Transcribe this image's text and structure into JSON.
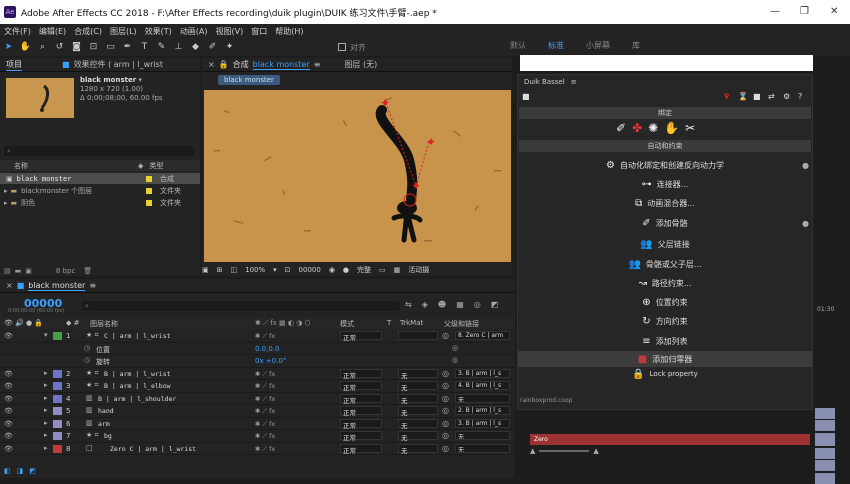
{
  "window": {
    "title": "Adobe After Effects CC 2018 - F:\\After Effects recording\\duik plugin\\DUIK 练习文件\\手臂-.aep *",
    "logo": "Ae"
  },
  "menu": [
    "文件(F)",
    "编辑(E)",
    "合成(C)",
    "图层(L)",
    "效果(T)",
    "动画(A)",
    "视图(V)",
    "窗口",
    "帮助(H)"
  ],
  "toolbar": {
    "snap_label": "对齐"
  },
  "workspaces": [
    "默认",
    "标准",
    "小屏幕",
    "库"
  ],
  "project": {
    "tab": "项目",
    "effects_tab": "效果控件 ( arm | l_wrist",
    "comp_name": "black monster",
    "comp_info1": "1280 x 720 (1.00)",
    "comp_info2": "Δ 0;00;08;00, 60.00 fps",
    "cols": [
      "名称",
      "类型"
    ],
    "items": [
      {
        "name": "black monster",
        "type": "合成"
      },
      {
        "name": "blackmonster 个图层",
        "type": "文件夹"
      },
      {
        "name": "阴色",
        "type": "文件夹"
      }
    ],
    "bpc": "8 bpc"
  },
  "comp": {
    "tab": "合成",
    "tab_name": "black monster",
    "layer_tab": "图层 (无)",
    "pill": "black monster",
    "zoom": "100%",
    "timecode": "00000",
    "quality": "完整",
    "camera": "活动摄"
  },
  "timeline": {
    "tab": "black monster",
    "timecode": "00000",
    "tc_sub": "0:00:00:00 (60.00 fps)",
    "cols": {
      "name": "图层名称",
      "mode": "模式",
      "t": "T",
      "trkmat": "TrkMat",
      "parent": "父级和链接"
    },
    "layers": [
      {
        "num": "1",
        "name": "C | arm | l_wrist",
        "mode": "正常",
        "trk": "",
        "parent": "8. Zero C | arm",
        "color": "#4a9e44",
        "expanded": true
      },
      {
        "num": "",
        "name": "位置",
        "value": "0.0,0.0",
        "sub": true
      },
      {
        "num": "",
        "name": "旋转",
        "value": "0x +0.0°",
        "sub": true
      },
      {
        "num": "2",
        "name": "B | arm | l_wrist",
        "mode": "正常",
        "trk": "无",
        "parent": "3. B | arm | l_s",
        "color": "#6e74c8"
      },
      {
        "num": "3",
        "name": "B | arm | l_elbow",
        "mode": "正常",
        "trk": "无",
        "parent": "4. B | arm | l_s",
        "color": "#6e74c8"
      },
      {
        "num": "4",
        "name": "B | arm | l_shoulder",
        "mode": "正常",
        "trk": "无",
        "parent": "无",
        "color": "#6e74c8"
      },
      {
        "num": "5",
        "name": "hand",
        "mode": "正常",
        "trk": "无",
        "parent": "2. B | arm | l_s",
        "color": "#8e8ec2"
      },
      {
        "num": "6",
        "name": "arm",
        "mode": "正常",
        "trk": "无",
        "parent": "3. B | arm | l_s",
        "color": "#8e8ec2"
      },
      {
        "num": "7",
        "name": "bg",
        "mode": "正常",
        "trk": "无",
        "parent": "无",
        "color": "#8e8ec2"
      },
      {
        "num": "8",
        "name": "Zero C | arm | l_wrist",
        "mode": "正常",
        "trk": "无",
        "parent": "无",
        "color": "#c23a3a"
      }
    ]
  },
  "duik": {
    "title": "Duik Bassel",
    "sec1": "绑定",
    "sec2": "自动和约束",
    "items": [
      {
        "label": "自动化绑定和创建反向动力学",
        "icon": "⚙"
      },
      {
        "label": "连接器...",
        "icon": "⊶"
      },
      {
        "label": "动画混合器...",
        "icon": "⧉"
      },
      {
        "label": "添加骨骼",
        "icon": "✐"
      },
      {
        "label": "父层链接",
        "icon": "👥"
      },
      {
        "label": "骨骼或父子层...",
        "icon": "👥"
      },
      {
        "label": "路径约束...",
        "icon": "↝"
      },
      {
        "label": "位置约束",
        "icon": "⊕"
      },
      {
        "label": "方向约束",
        "icon": "↻"
      },
      {
        "label": "添加列表",
        "icon": "≡"
      },
      {
        "label": "添加归零器",
        "icon": "■"
      },
      {
        "label": "Lock property",
        "icon": "🔒"
      }
    ],
    "footer": "rainboxprod.coop"
  },
  "right_timeline": {
    "ruler": "01:30",
    "zero_label": "Zero"
  },
  "colors": {
    "accent": "#3aa0ff",
    "sand": "#c8944c"
  }
}
